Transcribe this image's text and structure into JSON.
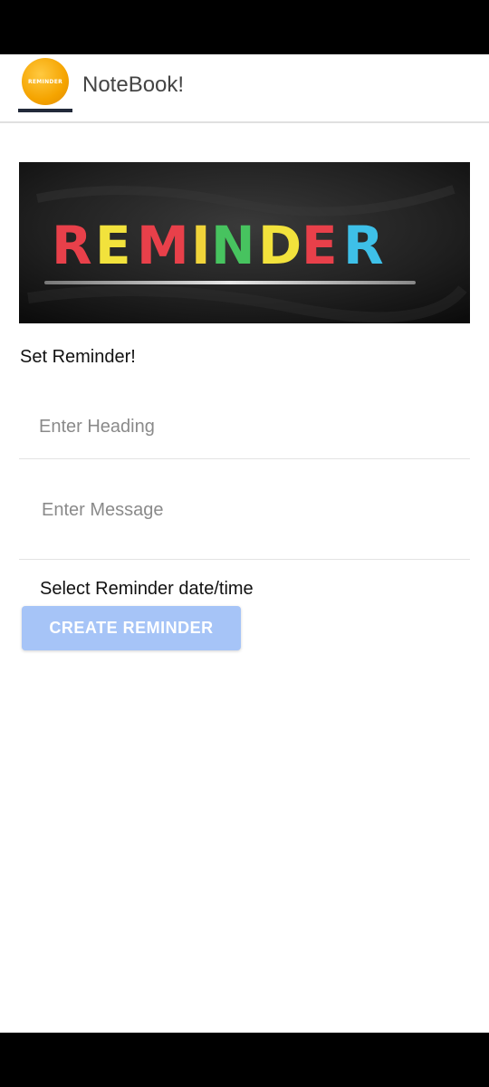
{
  "app": {
    "title": "NoteBook!",
    "logo_text": "REMINDER"
  },
  "hero": {
    "text": "REMINDER",
    "letter_colors": [
      "#e8404a",
      "#f2e23c",
      "#e8404a",
      "#f0d43a",
      "#47c35f",
      "#f2e23c",
      "#e8404a",
      "#3ec0e8"
    ]
  },
  "form": {
    "section_title": "Set Reminder!",
    "heading_placeholder": "Enter Heading",
    "heading_value": "",
    "message_placeholder": "Enter Message",
    "message_value": "",
    "date_label": "Select Reminder date/time",
    "create_button": "CREATE REMINDER"
  },
  "colors": {
    "button_bg": "#a6c4f7",
    "logo_bg": "#f5a400"
  }
}
